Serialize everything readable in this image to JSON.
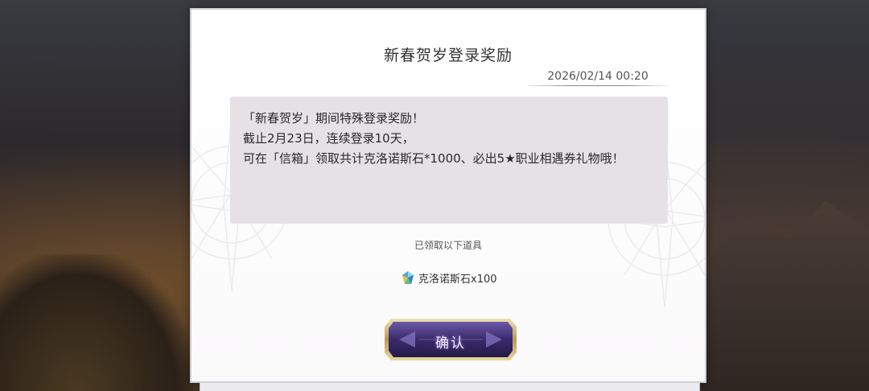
{
  "dialog": {
    "title": "新春贺岁登录奖励",
    "date": "2026/02/14 00:20",
    "message_lines": [
      "「新春贺岁」期间特殊登录奖励！",
      "截止2月23日，连续登录10天，",
      "可在「信箱」领取共计克洛诺斯石*1000、必出5★职业相遇券礼物哦！"
    ],
    "claimed_label": "已领取以下道具",
    "reward": {
      "icon": "crystal-gem-icon",
      "name": "克洛诺斯石x100"
    },
    "confirm_label": "确认"
  },
  "colors": {
    "panel_bg": "#ffffff",
    "message_bg": "#e6e1e5",
    "button_purple": "#3a2a6a",
    "button_gold": "#c9b27a"
  }
}
